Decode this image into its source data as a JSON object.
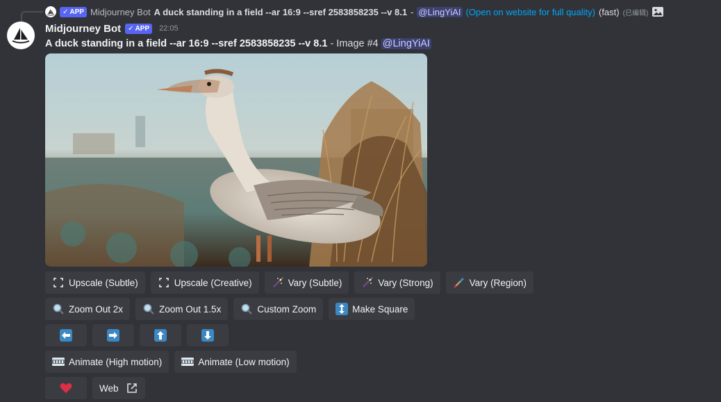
{
  "reply": {
    "author": "Midjourney Bot",
    "badge": "APP",
    "text": "A duck standing in a field --ar 16:9 --sref 2583858235 --v 8.1",
    "dash": "-",
    "mention": "@LingYiAI",
    "link": "(Open on website for full quality)",
    "speed": "(fast)",
    "edited": "(已编辑)"
  },
  "message": {
    "author": "Midjourney Bot",
    "badge": "APP",
    "timestamp": "22:05",
    "prompt": "A duck standing in a field --ar 16:9 --sref 2583858235 --v 8.1",
    "suffix": "- Image #4",
    "mention": "@LingYiAI"
  },
  "buttons": {
    "row1": [
      "Upscale (Subtle)",
      "Upscale (Creative)",
      "Vary (Subtle)",
      "Vary (Strong)",
      "Vary (Region)"
    ],
    "row2": [
      "Zoom Out 2x",
      "Zoom Out 1.5x",
      "Custom Zoom",
      "Make Square"
    ],
    "row4": [
      "Animate (High motion)",
      "Animate (Low motion)"
    ],
    "web": "Web"
  },
  "colors": {
    "background": "#313338",
    "button": "#3b3c42",
    "blurple": "#5865f2",
    "link": "#00a8fc",
    "arrow": "#3b88c3",
    "heart": "#dd2e44"
  }
}
